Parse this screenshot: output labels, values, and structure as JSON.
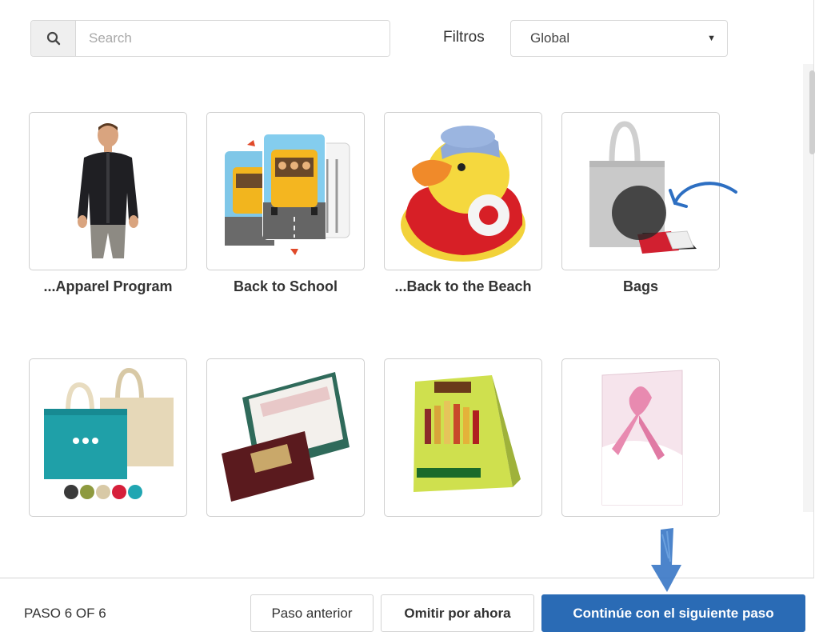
{
  "search": {
    "placeholder": "Search"
  },
  "filter": {
    "label": "Filtros",
    "selected": "Global"
  },
  "tiles": [
    {
      "label": "...Apparel Program",
      "selected": false
    },
    {
      "label": "Back to School",
      "selected": false
    },
    {
      "label": "...Back to the Beach",
      "selected": false
    },
    {
      "label": "Bags",
      "selected": true
    },
    {
      "label": "",
      "selected": false
    },
    {
      "label": "",
      "selected": false
    },
    {
      "label": "",
      "selected": false
    },
    {
      "label": "",
      "selected": false
    }
  ],
  "footer": {
    "step": "PASO 6 OF 6",
    "prev_label": "Paso anterior",
    "skip_label": "Omitir por ahora",
    "next_label": "Continúe con el siguiente paso"
  },
  "colors": {
    "primary": "#2a6bb5",
    "annotation": "#2d6fc2"
  }
}
